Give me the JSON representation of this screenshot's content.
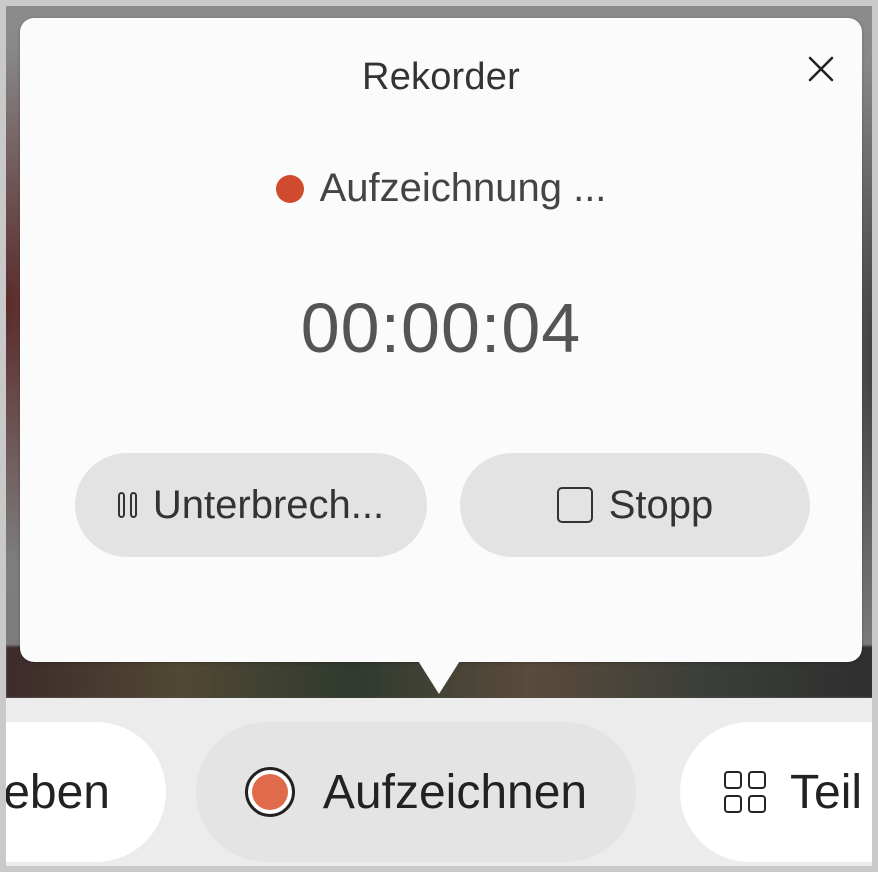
{
  "popup": {
    "title": "Rekorder",
    "close_symbol": "✕",
    "status_text": "Aufzeichnung ...",
    "status_color": "#d04a2f",
    "timer": "00:00:04",
    "pause_label": "Unterbrech...",
    "pause_icon": "pause-icon",
    "stop_label": "Stopp",
    "stop_icon": "stop-square-icon"
  },
  "toolbar": {
    "left_label": "eben",
    "record_label": "Aufzeichnen",
    "record_icon": "record-icon",
    "record_accent": "#e06a4c",
    "right_label": "Teil",
    "right_icon": "grid-icon"
  }
}
